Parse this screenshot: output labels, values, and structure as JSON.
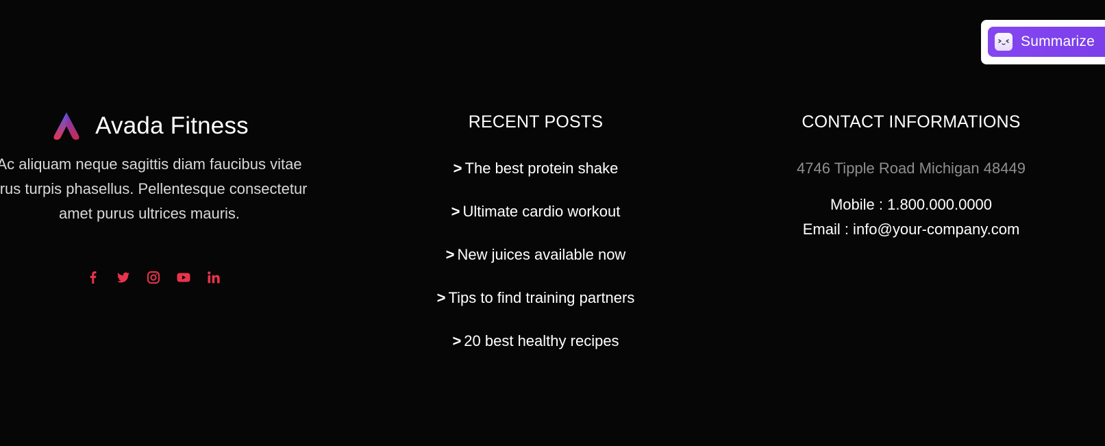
{
  "brand": {
    "name": "Avada Fitness",
    "logo_icon": "avada-logo-icon",
    "description_lines": [
      "Ac aliquam neque sagittis diam faucibus vitae",
      "urus turpis phasellus. Pellentesque consectetur",
      "amet purus ultrices mauris."
    ]
  },
  "socials": [
    {
      "name": "facebook-icon"
    },
    {
      "name": "twitter-icon"
    },
    {
      "name": "instagram-icon"
    },
    {
      "name": "youtube-icon"
    },
    {
      "name": "linkedin-icon"
    }
  ],
  "recent_posts": {
    "title": "RECENT POSTS",
    "items": [
      {
        "chevron": ">",
        "label": "The best protein shake"
      },
      {
        "chevron": ">",
        "label": "Ultimate cardio workout"
      },
      {
        "chevron": ">",
        "label": "New juices available now"
      },
      {
        "chevron": ">",
        "label": "Tips to find training partners"
      },
      {
        "chevron": ">",
        "label": "20 best healthy recipes"
      }
    ]
  },
  "contact": {
    "title": "CONTACT INFORMATIONS",
    "address": "4746 Tipple Road Michigan 48449",
    "mobile": "Mobile : 1.800.000.0000",
    "email": "Email : info@your-company.com"
  },
  "summarize": {
    "label": "Summarize",
    "icon": "summarize-face-icon"
  },
  "colors": {
    "background": "#060606",
    "social_icon": "#e8344a",
    "summarize_bg": "#8446f0",
    "address_text": "#8e8e8e"
  }
}
